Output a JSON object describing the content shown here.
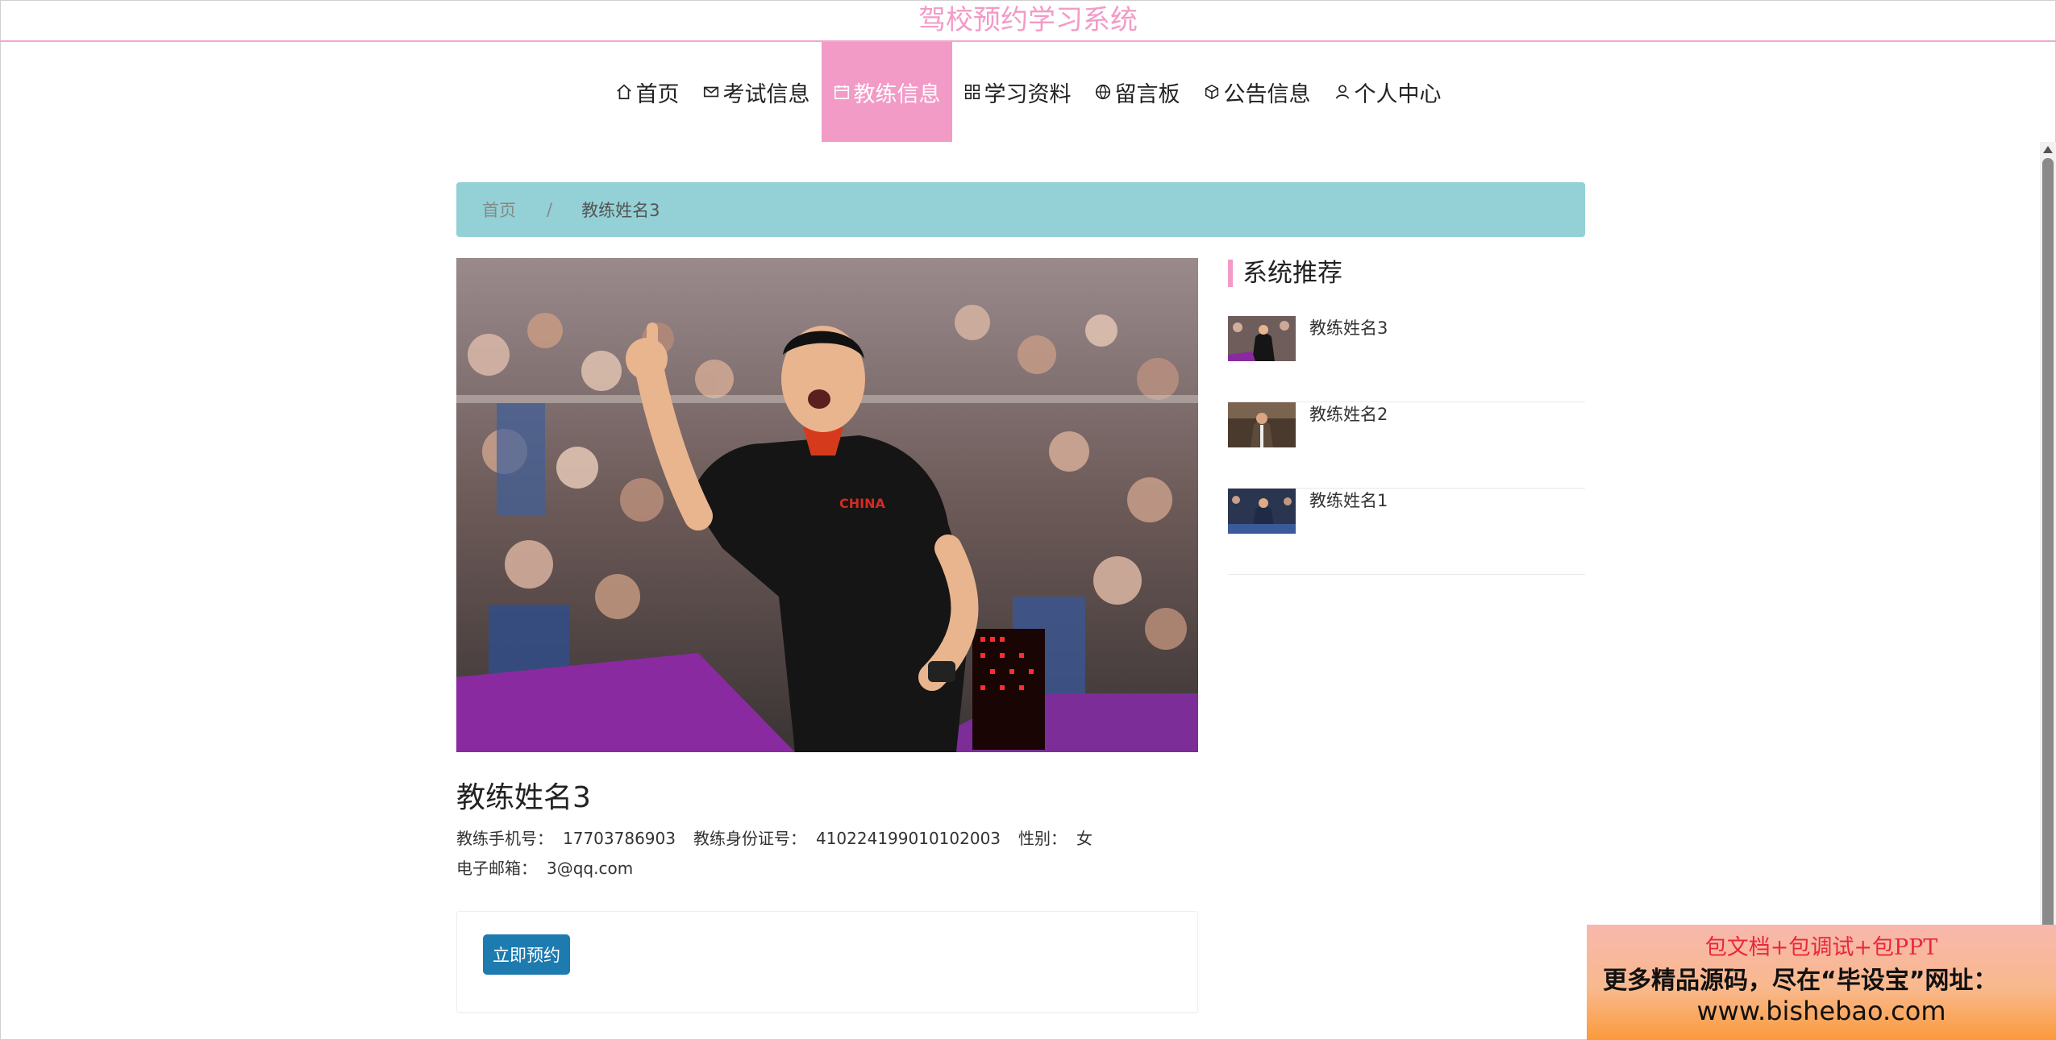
{
  "header": {
    "site_title": "驾校预约学习系统"
  },
  "nav": {
    "items": [
      {
        "label": "首页",
        "icon": "home-icon"
      },
      {
        "label": "考试信息",
        "icon": "mail-icon"
      },
      {
        "label": "教练信息",
        "icon": "calendar-icon",
        "active": true
      },
      {
        "label": "学习资料",
        "icon": "grid-icon"
      },
      {
        "label": "留言板",
        "icon": "globe-icon"
      },
      {
        "label": "公告信息",
        "icon": "cube-icon"
      },
      {
        "label": "个人中心",
        "icon": "user-icon"
      }
    ]
  },
  "breadcrumb": {
    "home": "首页",
    "separator": "/",
    "current": "教练姓名3"
  },
  "detail": {
    "name": "教练姓名3",
    "phone_label": "教练手机号：",
    "phone": "17703786903",
    "idcard_label": "教练身份证号：",
    "idcard": "410224199010102003",
    "gender_label": "性别：",
    "gender": "女",
    "email_label": "电子邮箱：",
    "email": "3@qq.com",
    "book_label": "立即预约"
  },
  "sidebar": {
    "title": "系统推荐",
    "items": [
      {
        "label": "教练姓名3"
      },
      {
        "label": "教练姓名2"
      },
      {
        "label": "教练姓名1"
      }
    ]
  },
  "ad": {
    "line1": "包文档+包调试+包PPT",
    "line2": "更多精品源码，尽在“毕设宝”网址：",
    "line3": "www.bishebao.com"
  },
  "colors": {
    "accent_pink": "#f29bc7",
    "breadcrumb_bg": "#93d1d7",
    "button_blue": "#1d7bb0"
  }
}
